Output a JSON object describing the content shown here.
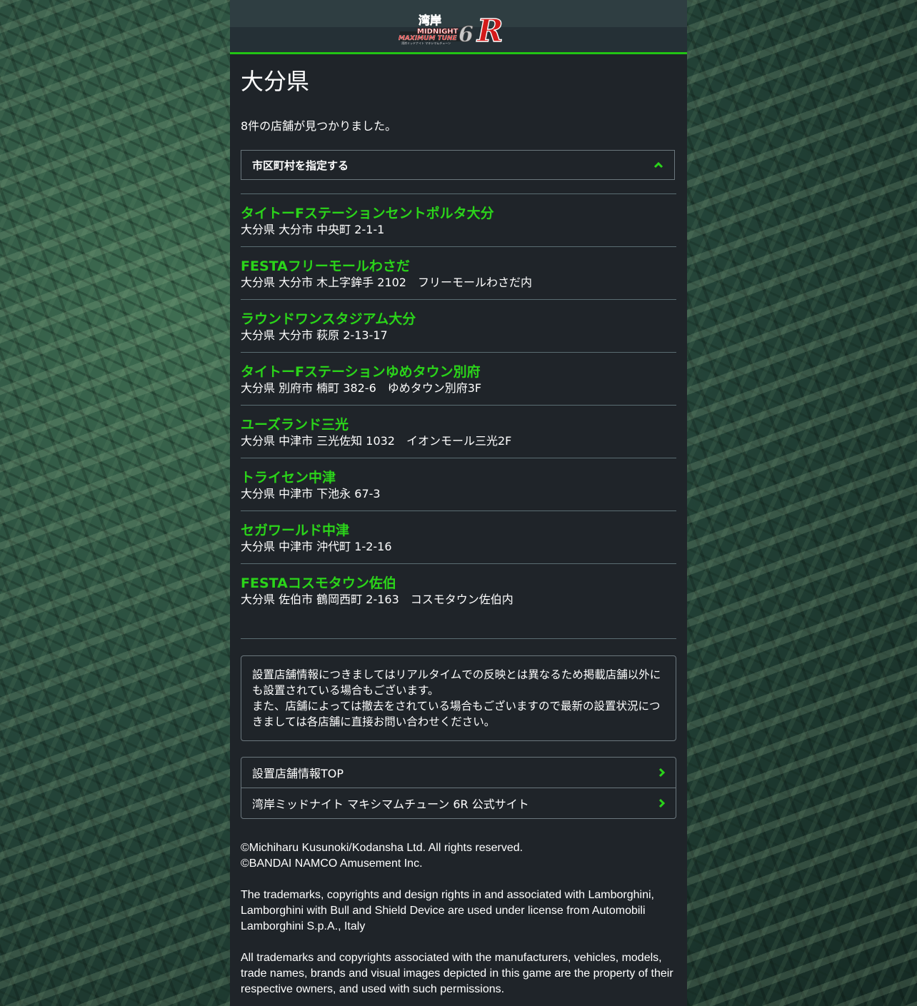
{
  "header": {
    "logo_alt": "湾岸 MIDNIGHT MAXIMUM TUNE 6R"
  },
  "page": {
    "title": "大分県",
    "result_count": "8件の店舗が見つかりました。"
  },
  "city_filter": {
    "label": "市区町村を指定する",
    "icon": "chevron-up-icon"
  },
  "stores": [
    {
      "name": "タイトーFステーションセントポルタ大分",
      "address": "大分県 大分市 中央町 2-1-1"
    },
    {
      "name": "FESTAフリーモールわさだ",
      "address": "大分県 大分市 木上字鉾手 2102　フリーモールわさだ内"
    },
    {
      "name": "ラウンドワンスタジアム大分",
      "address": "大分県 大分市 萩原 2-13-17"
    },
    {
      "name": "タイトーFステーションゆめタウン別府",
      "address": "大分県 別府市 楠町 382-6　ゆめタウン別府3F"
    },
    {
      "name": "ユーズランド三光",
      "address": "大分県 中津市 三光佐知 1032　イオンモール三光2F"
    },
    {
      "name": "トライセン中津",
      "address": "大分県 中津市 下池永 67-3"
    },
    {
      "name": "セガワールド中津",
      "address": "大分県 中津市 沖代町 1-2-16"
    },
    {
      "name": "FESTAコスモタウン佐伯",
      "address": "大分県 佐伯市 鶴岡西町 2-163　コスモタウン佐伯内"
    }
  ],
  "notice": {
    "line1": "設置店舗情報につきましてはリアルタイムでの反映とは異なるため掲載店舗以外にも設置されている場合もございます。",
    "line2": "また、店舗によっては撤去をされている場合もございますので最新の設置状況につきましては各店舗に直接お問い合わせください。"
  },
  "links": [
    {
      "label": "設置店舗情報TOP",
      "icon": "chevron-right-icon"
    },
    {
      "label": "湾岸ミッドナイト マキシマムチューン 6R 公式サイト",
      "icon": "chevron-right-icon"
    }
  ],
  "footer": {
    "copyright1": "©Michiharu Kusunoki/Kodansha Ltd. All rights reserved.",
    "copyright2": "©BANDAI NAMCO Amusement Inc.",
    "trademark_lamborghini": "The trademarks, copyrights and design rights in and associated with Lamborghini, Lamborghini with Bull and Shield Device are used under license from Automobili Lamborghini S.p.A., Italy",
    "trademark_general": "All trademarks and copyrights associated with the manufacturers, vehicles, models, trade names, brands and visual images depicted in this game are the property of their respective owners, and used with such permissions."
  },
  "colors": {
    "accent_green": "#22c414",
    "store_name_green": "#2bd41a",
    "panel_bg": "#1f2429",
    "border": "#6b777d"
  }
}
